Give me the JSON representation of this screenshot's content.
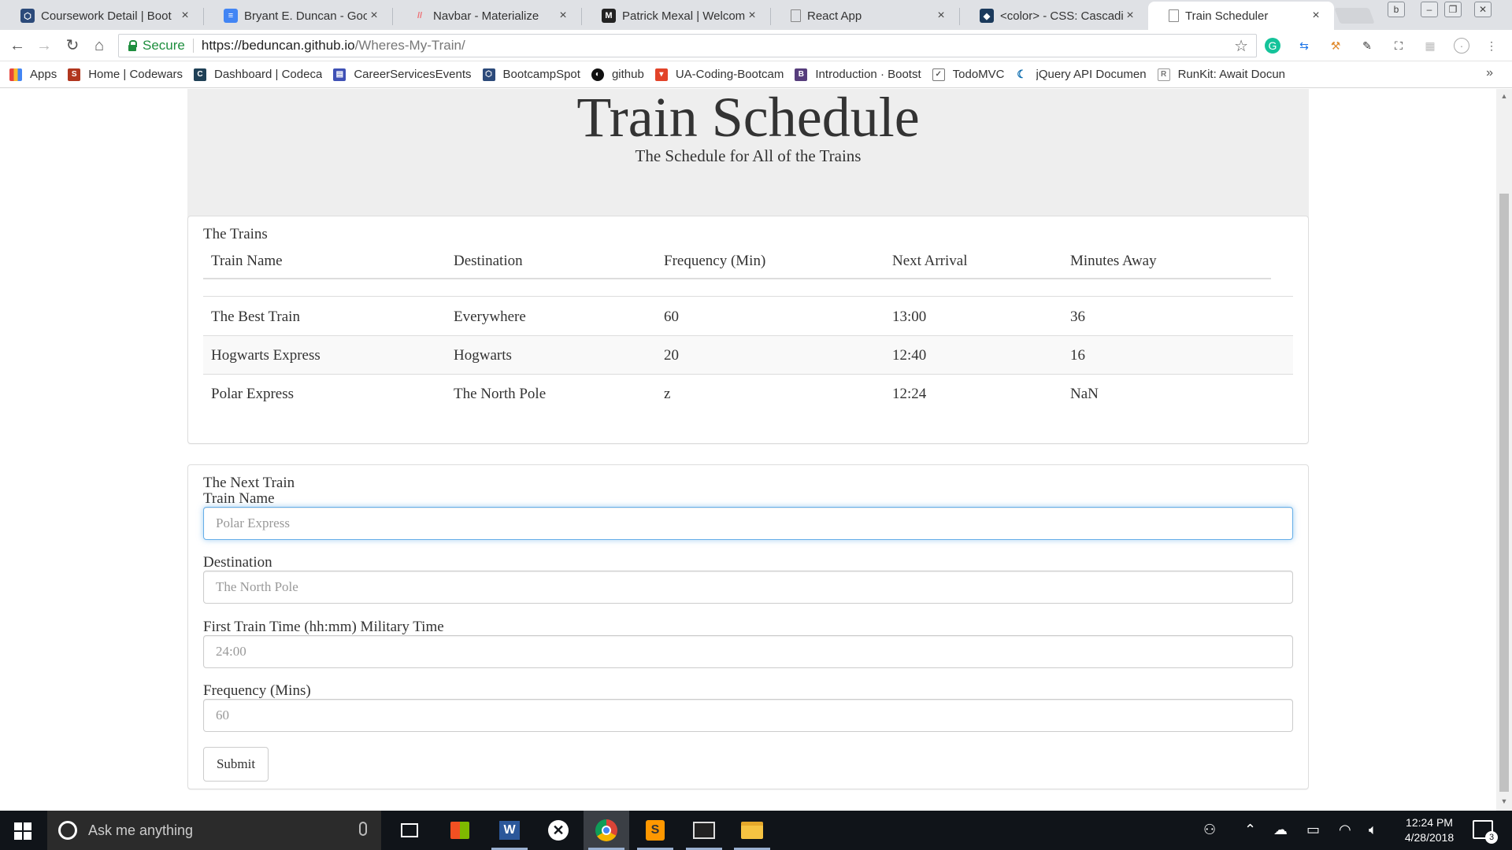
{
  "browser": {
    "tabs": [
      {
        "title": "Coursework Detail | Boot",
        "icon": "bootcamp-hex-icon",
        "color": "#2c4a7a"
      },
      {
        "title": "Bryant E. Duncan - Googl",
        "icon": "google-docs-icon",
        "color": "#4285f4"
      },
      {
        "title": "Navbar - Materialize",
        "icon": "materialize-icon",
        "color": "#ee6e73"
      },
      {
        "title": "Patrick Mexal | Welcome",
        "icon": "m-logo-icon",
        "color": "#222222"
      },
      {
        "title": "React App",
        "icon": "page-icon",
        "color": "#888888"
      },
      {
        "title": "<color> - CSS: Cascading",
        "icon": "mdn-dino-icon",
        "color": "#1b3a5c"
      },
      {
        "title": "Train Scheduler",
        "icon": "page-icon",
        "color": "#888888"
      }
    ],
    "active_tab": 6,
    "address": {
      "secure_label": "Secure",
      "url_host": "https://beduncan.github.io",
      "url_path": "/Wheres-My-Train/"
    },
    "bookmarks": [
      {
        "label": "Apps",
        "icon": "apps-grid-icon",
        "color": "#e8453c"
      },
      {
        "label": "Home | Codewars",
        "icon": "codewars-icon",
        "color": "#b1361e"
      },
      {
        "label": "Dashboard | Codeca",
        "icon": "codecademy-icon",
        "color": "#1f4056"
      },
      {
        "label": "CareerServicesEvents",
        "icon": "calendar-icon",
        "color": "#3f51b5"
      },
      {
        "label": "BootcampSpot",
        "icon": "bootcamp-hex-icon",
        "color": "#2c4a7a"
      },
      {
        "label": "github",
        "icon": "github-icon",
        "color": "#111111"
      },
      {
        "label": "UA-Coding-Bootcam",
        "icon": "gitlab-icon",
        "color": "#e24329"
      },
      {
        "label": "Introduction · Bootst",
        "icon": "bootstrap-icon",
        "color": "#563d7c"
      },
      {
        "label": "TodoMVC",
        "icon": "todomvc-icon",
        "color": "#555555"
      },
      {
        "label": "jQuery API Documen",
        "icon": "jquery-icon",
        "color": "#0769ad"
      },
      {
        "label": "RunKit: Await Docun",
        "icon": "runkit-icon",
        "color": "#777777"
      }
    ],
    "bookmarks_more": "»"
  },
  "page": {
    "jumbotron": {
      "title": "Train Schedule",
      "subtitle": "The Schedule for All of the Trains"
    },
    "trains_panel": {
      "heading": "The Trains",
      "columns": [
        "Train Name",
        "Destination",
        "Frequency (Min)",
        "Next Arrival",
        "Minutes Away"
      ],
      "rows": [
        [
          "The Best Train",
          "Everywhere",
          "60",
          "13:00",
          "36"
        ],
        [
          "Hogwarts Express",
          "Hogwarts",
          "20",
          "12:40",
          "16"
        ],
        [
          "Polar Express",
          "The North Pole",
          "z",
          "12:24",
          "NaN"
        ]
      ]
    },
    "form_panel": {
      "heading": "The Next Train",
      "name_label": "Train Name",
      "name_placeholder": "Polar Express",
      "destination_label": "Destination",
      "destination_placeholder": "The North Pole",
      "first_time_label": "First Train Time (hh:mm) Military Time",
      "first_time_placeholder": "24:00",
      "frequency_label": "Frequency (Mins)",
      "frequency_placeholder": "60",
      "submit_label": "Submit"
    }
  },
  "taskbar": {
    "search_placeholder": "Ask me anything",
    "time": "12:24 PM",
    "date": "4/28/2018",
    "notification_count": "3"
  }
}
